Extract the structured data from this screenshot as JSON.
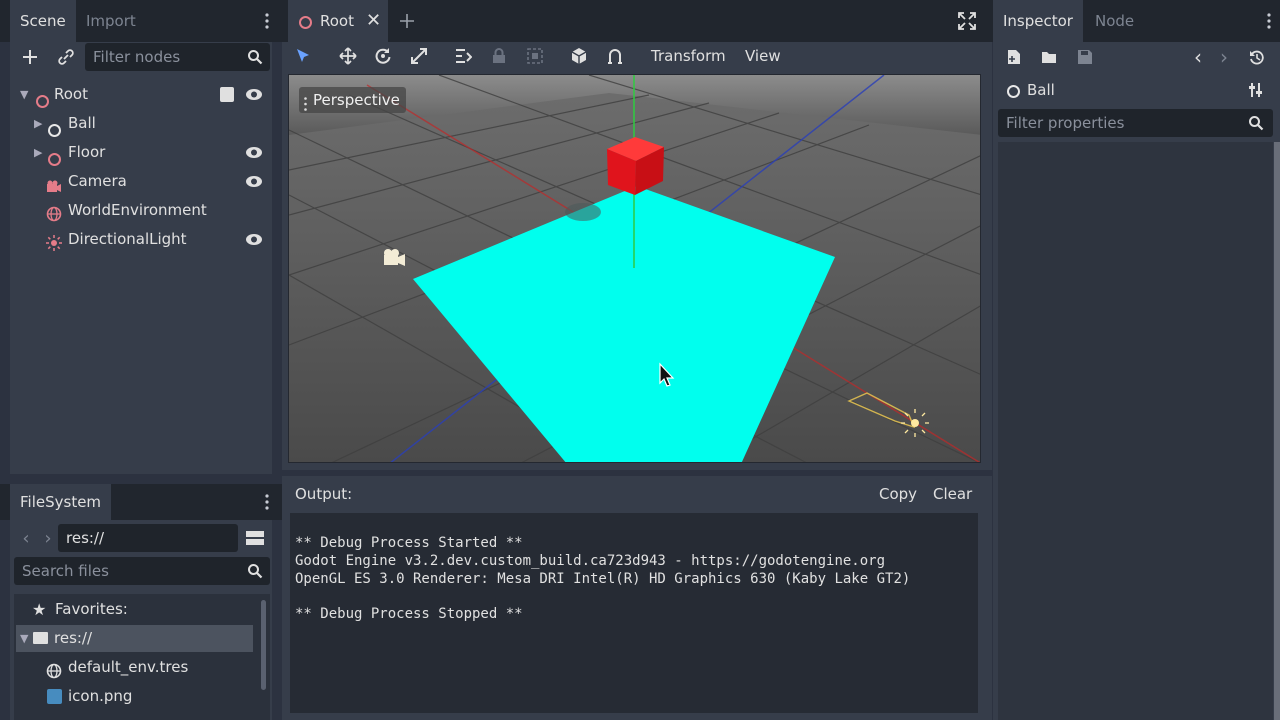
{
  "scene_dock": {
    "tabs": [
      "Scene",
      "Import"
    ],
    "filter_placeholder": "Filter nodes",
    "nodes": [
      {
        "label": "Root"
      },
      {
        "label": "Ball"
      },
      {
        "label": "Floor"
      },
      {
        "label": "Camera"
      },
      {
        "label": "WorldEnvironment"
      },
      {
        "label": "DirectionalLight"
      }
    ]
  },
  "filesystem_dock": {
    "tab": "FileSystem",
    "path": "res://",
    "search_placeholder": "Search files",
    "items": [
      {
        "label": "Favorites:"
      },
      {
        "label": "res://"
      },
      {
        "label": "default_env.tres"
      },
      {
        "label": "icon.png"
      }
    ]
  },
  "editor": {
    "tab_label": "Root",
    "menus": {
      "transform": "Transform",
      "view": "View"
    },
    "viewport_label": "Perspective"
  },
  "output": {
    "label": "Output:",
    "copy": "Copy",
    "clear": "Clear",
    "lines": [
      "** Debug Process Started **",
      "Godot Engine v3.2.dev.custom_build.ca723d943 - https://godotengine.org",
      "OpenGL ES 3.0 Renderer: Mesa DRI Intel(R) HD Graphics 630 (Kaby Lake GT2)",
      "** Debug Process Stopped **"
    ]
  },
  "inspector": {
    "tabs": [
      "Inspector",
      "Node"
    ],
    "object_name": "Ball",
    "filter_placeholder": "Filter properties"
  },
  "colors": {
    "floor": "#00ffee",
    "cube": "#e8141c",
    "accent": "#6aa2ff"
  }
}
